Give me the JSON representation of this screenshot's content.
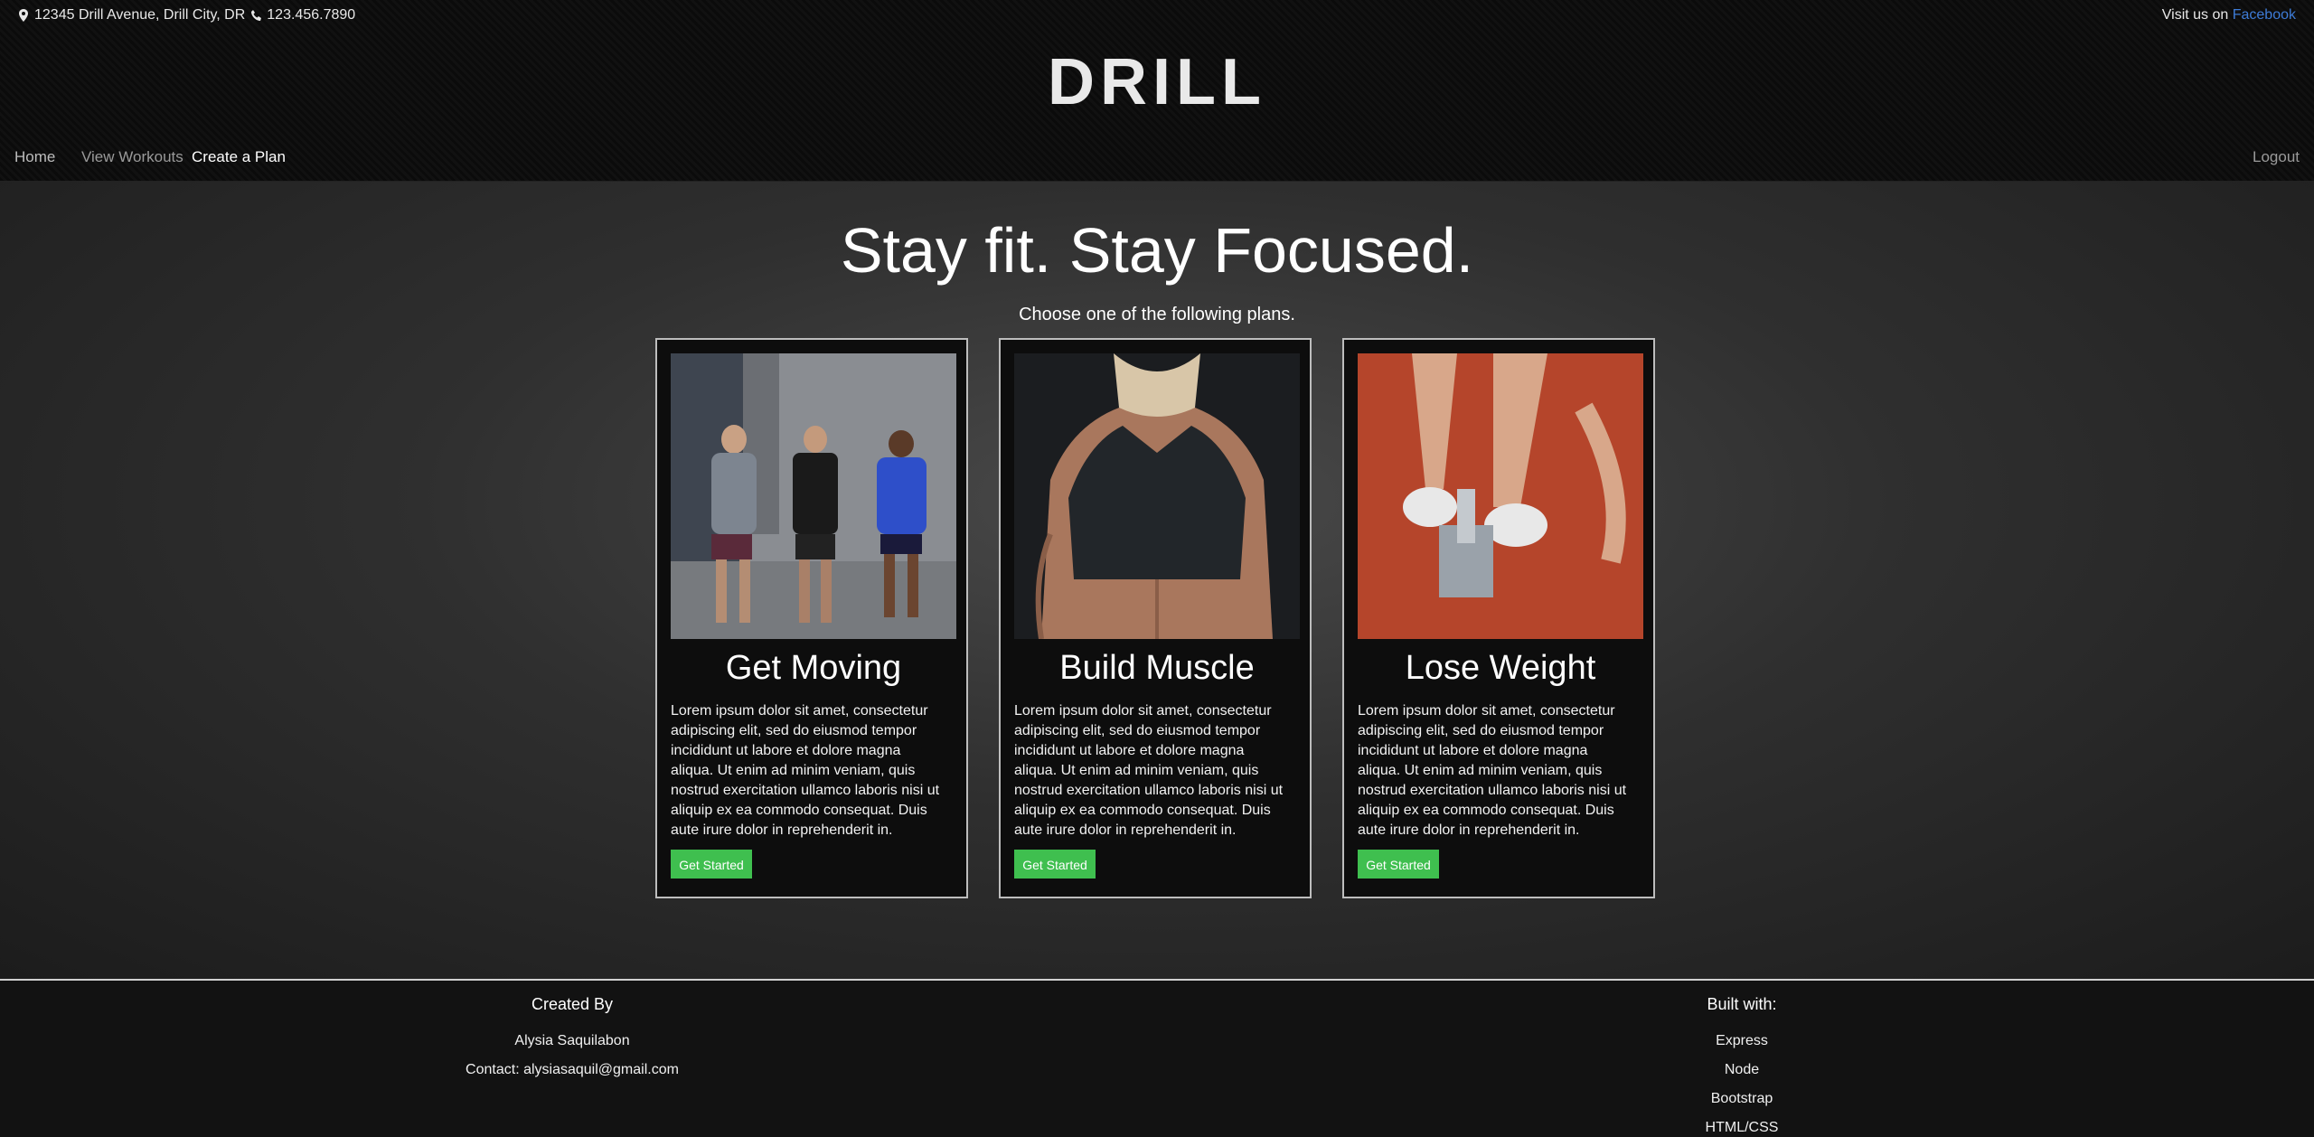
{
  "topbar": {
    "address": "12345 Drill Avenue, Drill City, DR",
    "phone": "123.456.7890",
    "visit_text": "Visit us on ",
    "facebook_link": "Facebook"
  },
  "logo": "DRILL",
  "nav": {
    "home": "Home",
    "view_workouts": "View Workouts",
    "create_plan": "Create a Plan",
    "logout": "Logout"
  },
  "hero": {
    "title": "Stay fit. Stay Focused.",
    "subtitle": "Choose one of the following plans."
  },
  "cards": [
    {
      "title": "Get Moving",
      "description": "Lorem ipsum dolor sit amet, consectetur adipiscing elit, sed do eiusmod tempor incididunt ut labore et dolore magna aliqua. Ut enim ad minim veniam, quis nostrud exercitation ullamco laboris nisi ut aliquip ex ea commodo consequat. Duis aute irure dolor in reprehenderit in.",
      "button": "Get Started"
    },
    {
      "title": "Build Muscle",
      "description": "Lorem ipsum dolor sit amet, consectetur adipiscing elit, sed do eiusmod tempor incididunt ut labore et dolore magna aliqua. Ut enim ad minim veniam, quis nostrud exercitation ullamco laboris nisi ut aliquip ex ea commodo consequat. Duis aute irure dolor in reprehenderit in.",
      "button": "Get Started"
    },
    {
      "title": "Lose Weight",
      "description": "Lorem ipsum dolor sit amet, consectetur adipiscing elit, sed do eiusmod tempor incididunt ut labore et dolore magna aliqua. Ut enim ad minim veniam, quis nostrud exercitation ullamco laboris nisi ut aliquip ex ea commodo consequat. Duis aute irure dolor in reprehenderit in.",
      "button": "Get Started"
    }
  ],
  "footer": {
    "created_by_label": "Created By",
    "author": "Alysia Saquilabon",
    "contact": "Contact: alysiasaquil@gmail.com",
    "built_with_label": "Built with:",
    "tech": [
      "Express",
      "Node",
      "Bootstrap",
      "HTML/CSS"
    ]
  },
  "colors": {
    "accent_green": "#3fbf4f",
    "link_blue": "#3d7bd6"
  }
}
